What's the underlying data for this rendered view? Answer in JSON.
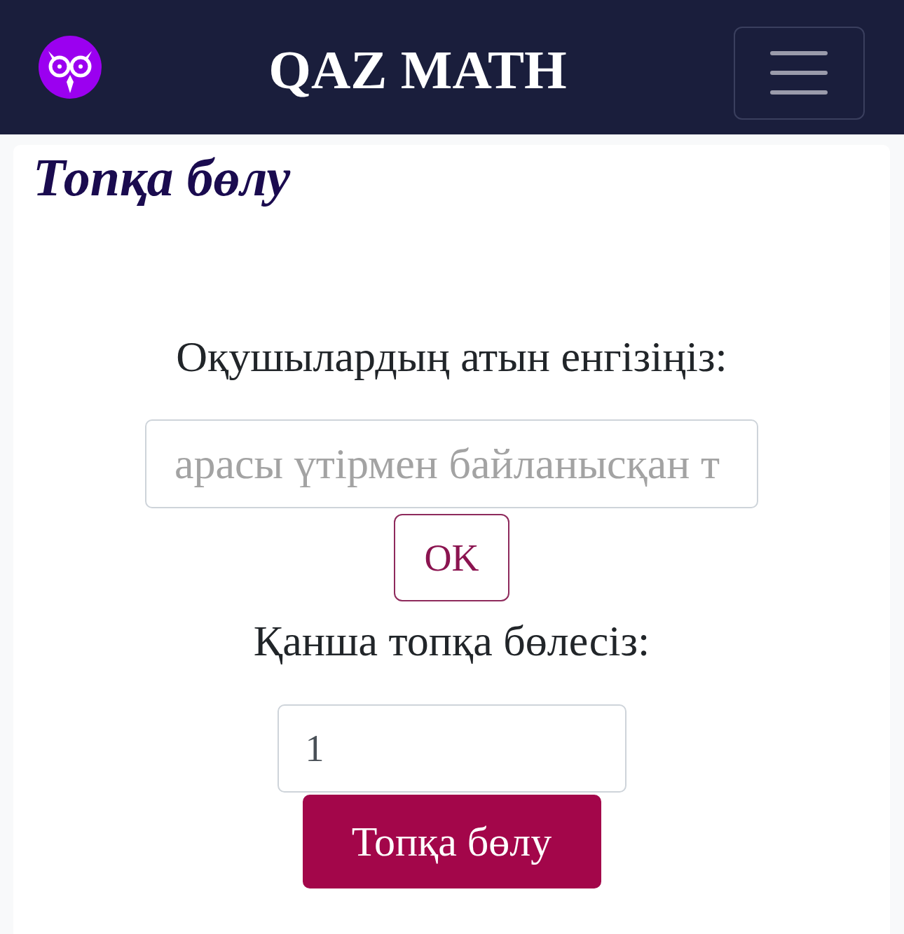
{
  "navbar": {
    "brand": "QAZ MATH"
  },
  "card": {
    "title": "Топқа бөлу",
    "form": [
      {
        "kind": "label",
        "text": "Оқушылардың атын енгізіңіз:"
      },
      {
        "kind": "text_input",
        "placeholder": "арасы үтірмен байланысқан т"
      },
      {
        "kind": "outline_button",
        "label": "OK"
      },
      {
        "kind": "label",
        "text": "Қанша топқа бөлесіз:"
      },
      {
        "kind": "number_input",
        "value": "1"
      },
      {
        "kind": "primary_button",
        "label": "Топқа бөлу"
      }
    ]
  }
}
